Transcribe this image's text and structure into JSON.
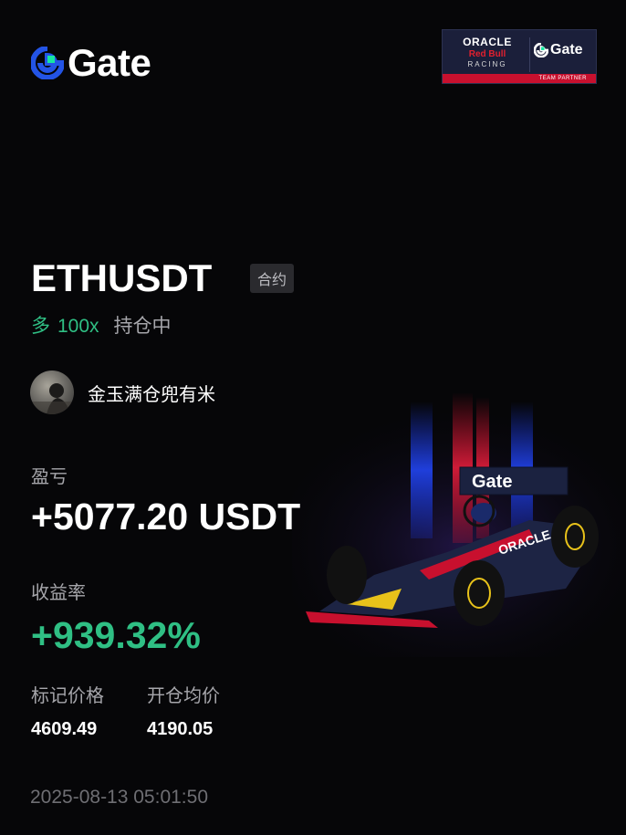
{
  "brand": {
    "name": "Gate",
    "icon": "gate-logo-icon",
    "accent": "#2354E6",
    "accent2": "#17E6A1"
  },
  "partner_badge": {
    "oracle": "ORACLE",
    "redbull": "Red Bull",
    "racing": "RACING",
    "gate": "Gate",
    "tagline": "TEAM PARTNER"
  },
  "position": {
    "pair": "ETHUSDT",
    "type_tag": "合约",
    "direction": "多",
    "leverage": "100x",
    "status": "持仓中"
  },
  "user": {
    "name": "金玉满仓兜有米",
    "avatar": "avatar-icon"
  },
  "pnl": {
    "label": "盈亏",
    "value": "+5077.20 USDT"
  },
  "roi": {
    "label": "收益率",
    "value": "+939.32%"
  },
  "prices": {
    "mark_label": "标记价格",
    "mark_value": "4609.49",
    "entry_label": "开仓均价",
    "entry_value": "4190.05"
  },
  "timestamp": "2025-08-13 05:01:50",
  "colors": {
    "positive": "#2FBF84",
    "muted": "#A6A6AB",
    "background": "#060608"
  }
}
